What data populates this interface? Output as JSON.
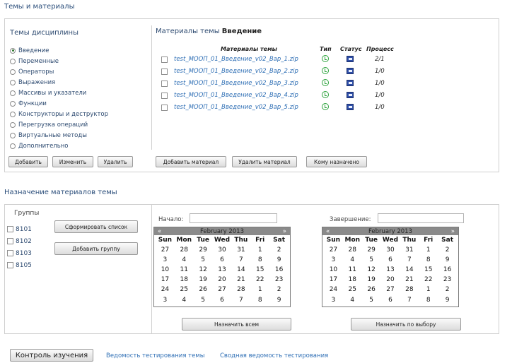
{
  "themes_section": {
    "title": "Темы и материалы"
  },
  "disciplines": {
    "title": "Темы дисциплины",
    "items": [
      {
        "label": "Введение",
        "selected": true
      },
      {
        "label": "Переменные",
        "selected": false
      },
      {
        "label": "Операторы",
        "selected": false
      },
      {
        "label": "Выражения",
        "selected": false
      },
      {
        "label": "Массивы и указатели",
        "selected": false
      },
      {
        "label": "Функции",
        "selected": false
      },
      {
        "label": "Конструкторы и деструктор",
        "selected": false
      },
      {
        "label": "Перегрузка операций",
        "selected": false
      },
      {
        "label": "Виртуальные методы",
        "selected": false
      },
      {
        "label": "Дополнительно",
        "selected": false
      }
    ],
    "buttons": {
      "add": "Добавить",
      "edit": "Изменить",
      "delete": "Удалить"
    }
  },
  "materials": {
    "title_prefix": "Материалы темы",
    "title_topic": "Введение",
    "columns": {
      "name": "Материалы темы",
      "type": "Тип",
      "status": "Статус",
      "progress": "Процесс"
    },
    "rows": [
      {
        "file": "test_MOOП_01_Введение_v02_Вар_1.zip",
        "progress": "2/1"
      },
      {
        "file": "test_MOOП_01_Введение_v02_Вар_2.zip",
        "progress": "1/0"
      },
      {
        "file": "test_MOOП_01_Введение_v02_Вар_3.zip",
        "progress": "1/0"
      },
      {
        "file": "test_MOOП_01_Введение_v02_Вар_4.zip",
        "progress": "1/0"
      },
      {
        "file": "test_MOOП_01_Введение_v02_Вар_5.zip",
        "progress": "1/0"
      }
    ],
    "buttons": {
      "add": "Добавить материал",
      "delete": "Удалить материал",
      "assigned": "Кому назначено"
    }
  },
  "assign_section": {
    "title": "Назначение материалов темы"
  },
  "groups": {
    "title": "Группы",
    "items": [
      "8101",
      "8102",
      "8103",
      "8105"
    ],
    "form_list": "Сформировать список",
    "add_group": "Добавить группу"
  },
  "start": {
    "label": "Начало:",
    "calendar": {
      "month": "February 2013",
      "prev": "«",
      "next": "»",
      "dow": [
        "Sun",
        "Mon",
        "Tue",
        "Wed",
        "Thu",
        "Fri",
        "Sat"
      ],
      "days": [
        "27",
        "28",
        "29",
        "30",
        "31",
        "1",
        "2",
        "3",
        "4",
        "5",
        "6",
        "7",
        "8",
        "9",
        "10",
        "11",
        "12",
        "13",
        "14",
        "15",
        "16",
        "17",
        "18",
        "19",
        "20",
        "21",
        "22",
        "23",
        "24",
        "25",
        "26",
        "27",
        "28",
        "1",
        "2",
        "3",
        "4",
        "5",
        "6",
        "7",
        "8",
        "9"
      ]
    }
  },
  "end": {
    "label": "Завершение:",
    "calendar": {
      "month": "February 2013",
      "prev": "«",
      "next": "»",
      "dow": [
        "Sun",
        "Mon",
        "Tue",
        "Wed",
        "Thu",
        "Fri",
        "Sat"
      ],
      "days": [
        "27",
        "28",
        "29",
        "30",
        "31",
        "1",
        "2",
        "3",
        "4",
        "5",
        "6",
        "7",
        "8",
        "9",
        "10",
        "11",
        "12",
        "13",
        "14",
        "15",
        "16",
        "17",
        "18",
        "19",
        "20",
        "21",
        "22",
        "23",
        "24",
        "25",
        "26",
        "27",
        "28",
        "1",
        "2",
        "3",
        "4",
        "5",
        "6",
        "7",
        "8",
        "9"
      ]
    }
  },
  "assign_buttons": {
    "all": "Назначить всем",
    "selected": "Назначить по выбору"
  },
  "footer": {
    "control": "Контроль изучения",
    "link1": "Ведомость тестирования темы",
    "link2": "Сводная ведомость тестирования"
  },
  "colors": {
    "link": "#2f6fb5",
    "type_icon": "#2aa23a",
    "status_icon": "#2f4fa8",
    "calendar_header": "#8a8a8a"
  }
}
